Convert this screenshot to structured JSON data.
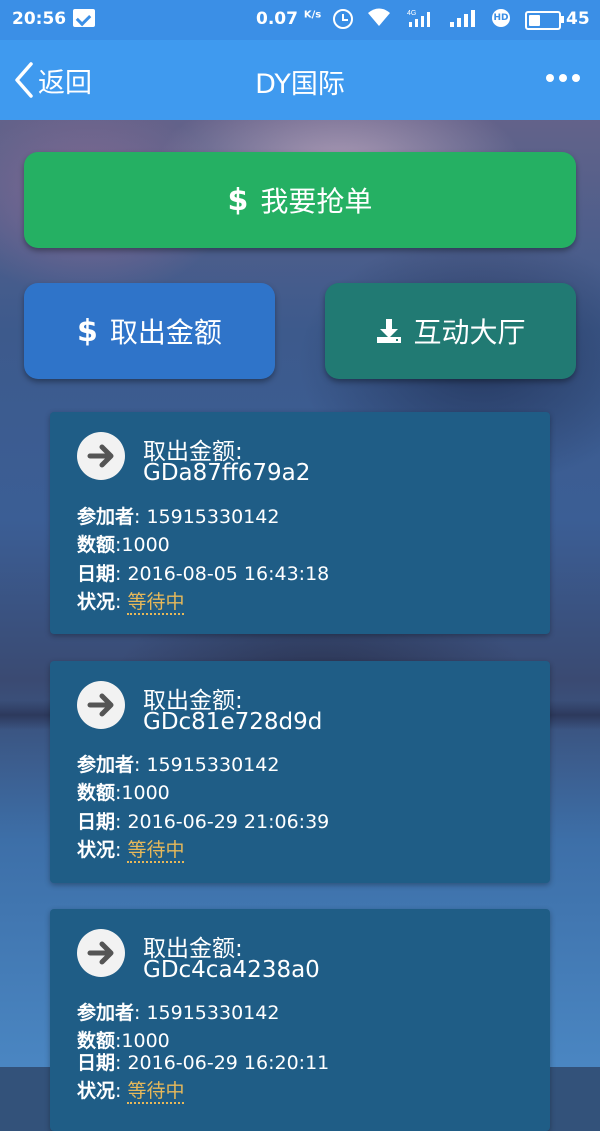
{
  "status_bar": {
    "time": "20:56",
    "net_speed": "0.07",
    "net_unit": "K/s",
    "signal_tag": "4G",
    "hd_badge": "HD",
    "battery_level": 0.45,
    "battery_text": "45"
  },
  "nav": {
    "back_label": "返回",
    "title": "DY国际"
  },
  "actions": {
    "grab_order": "我要抢单",
    "withdraw": "取出金额",
    "hall": "互动大厅",
    "dollar": "$"
  },
  "labels": {
    "participant": "参加者",
    "amount": "数额",
    "date": "日期",
    "status": "状况"
  },
  "records": [
    {
      "title": "取出金额:",
      "id": "GDa87ff679a2",
      "participant": ": 15915330142",
      "amount": ":1000",
      "date": ": 2016-08-05 16:43:18",
      "status_sep": ": ",
      "status": "等待中"
    },
    {
      "title": "取出金额:",
      "id": "GDc81e728d9d",
      "participant": ": 15915330142",
      "amount": ":1000",
      "date": ": 2016-06-29 21:06:39",
      "status_sep": ": ",
      "status": "等待中"
    },
    {
      "title": "取出金额:",
      "id": "GDc4ca4238a0",
      "participant": ": 15915330142",
      "amount": ":1000",
      "date": ": 2016-06-29 16:20:11",
      "status_sep": ": ",
      "status": "等待中"
    }
  ],
  "colors": {
    "grab_button": "#25b063",
    "withdraw_button": "#2f74c9",
    "hall_button": "#217a73",
    "card_bg": "#1f5d86",
    "status_pending": "#e6b85a",
    "nav_bg": "#3f9aef"
  }
}
